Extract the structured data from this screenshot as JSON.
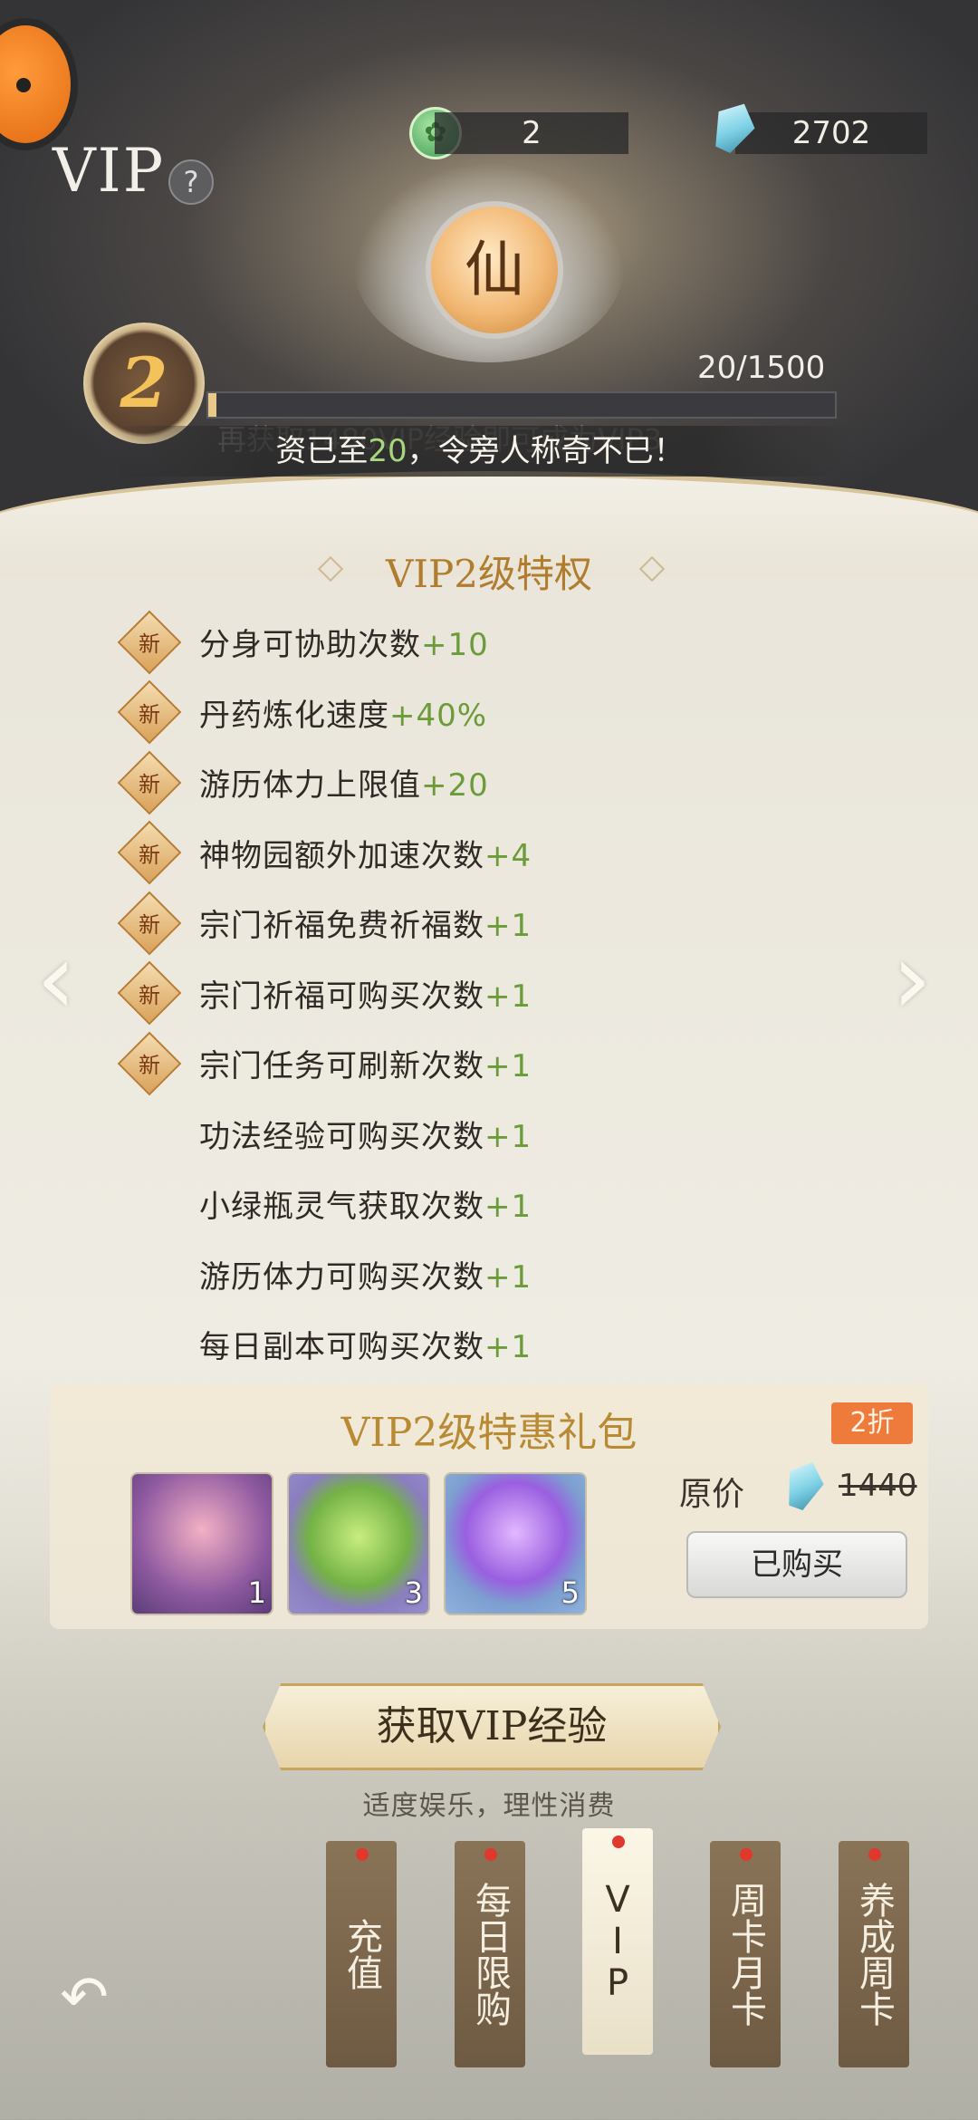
{
  "header": {
    "title": "VIP",
    "help_icon": "?",
    "jade": {
      "value": "2",
      "icon": "jade-token-icon"
    },
    "gems": {
      "value": "2702",
      "icon": "diamond-icon"
    },
    "emblem_char": "仙"
  },
  "level": {
    "current": "2",
    "progress_text": "20/1500",
    "progress_fraction": 0.0133,
    "hint_text": "再获取1480VIP经验即可成为VIP3",
    "caption_prefix": "资已至",
    "caption_value": "20",
    "caption_suffix": "，令旁人称奇不已！"
  },
  "privileges": {
    "title": "VIP2级特权",
    "new_label": "新",
    "items": [
      {
        "label": "分身可协助次数",
        "value": "+10",
        "is_new": true
      },
      {
        "label": "丹药炼化速度",
        "value": "+40%",
        "is_new": true
      },
      {
        "label": "游历体力上限值",
        "value": "+20",
        "is_new": true
      },
      {
        "label": "神物园额外加速次数",
        "value": "+4",
        "is_new": true
      },
      {
        "label": "宗门祈福免费祈福数",
        "value": "+1",
        "is_new": true
      },
      {
        "label": "宗门祈福可购买次数",
        "value": "+1",
        "is_new": true
      },
      {
        "label": "宗门任务可刷新次数",
        "value": "+1",
        "is_new": true
      },
      {
        "label": "功法经验可购买次数",
        "value": "+1",
        "is_new": false
      },
      {
        "label": "小绿瓶灵气获取次数",
        "value": "+1",
        "is_new": false
      },
      {
        "label": "游历体力可购买次数",
        "value": "+1",
        "is_new": false
      },
      {
        "label": "每日副本可购买次数",
        "value": "+1",
        "is_new": false
      }
    ]
  },
  "nav": {
    "prev": "‹",
    "next": "›"
  },
  "package": {
    "title": "VIP2级特惠礼包",
    "discount": "2折",
    "original_price_label": "原价",
    "original_price": "1440",
    "button_label": "已购买",
    "items": [
      {
        "name": "lotus-relic-icon",
        "count": "1"
      },
      {
        "name": "green-orb-icon",
        "count": "3"
      },
      {
        "name": "purple-orb-icon",
        "count": "5"
      }
    ]
  },
  "get_exp_button": "获取VIP经验",
  "notice": "适度娱乐，理性消费",
  "tabs": [
    {
      "label": "充值",
      "active": false
    },
    {
      "label": "每日限购",
      "active": false
    },
    {
      "label": "VIP",
      "active": true
    },
    {
      "label": "周卡月卡",
      "active": false
    },
    {
      "label": "养成周卡",
      "active": false
    }
  ],
  "colors": {
    "gold": "#b07d2e",
    "bonus_green": "#6c9c3a",
    "discount_orange": "#ee7a3c"
  }
}
